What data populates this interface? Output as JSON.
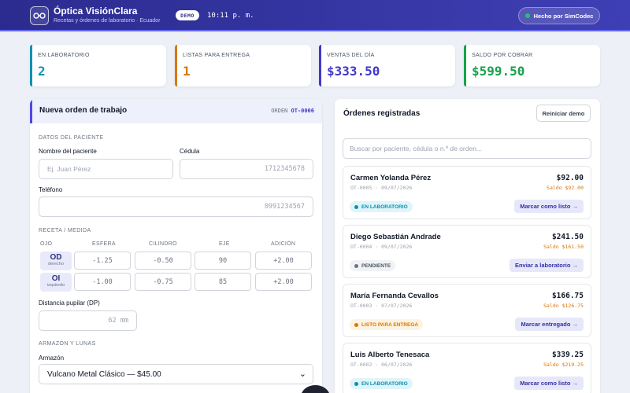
{
  "header": {
    "title": "Óptica VisiónClara",
    "subtitle": "Recetas y órdenes de laboratorio · Ecuador",
    "demo_badge": "DEMO",
    "clock": "10:11 p. m.",
    "made_by": "Hecho por SimCodec",
    "icon": "glasses-icon"
  },
  "stats": [
    {
      "label": "EN LABORATORIO",
      "value": "2",
      "color": "#0891b2"
    },
    {
      "label": "LISTAS PARA ENTREGA",
      "value": "1",
      "color": "#d97706"
    },
    {
      "label": "VENTAS DEL DÍA",
      "value": "$333.50",
      "color": "#4338ca"
    },
    {
      "label": "SALDO POR COBRAR",
      "value": "$599.50",
      "color": "#16a34a"
    }
  ],
  "form": {
    "title": "Nueva orden de trabajo",
    "order_label": "ORDEN",
    "order_code": "OT-0006",
    "patient_section": "DATOS DEL PACIENTE",
    "name_label": "Nombre del paciente",
    "name_placeholder": "Ej. Juan Pérez",
    "id_label": "Cédula",
    "id_placeholder": "1712345678",
    "phone_label": "Teléfono",
    "phone_placeholder": "0991234567",
    "rx_section": "RECETA / MEDIDA",
    "columns": [
      "OJO",
      "ESFERA",
      "CILINDRO",
      "EJE",
      "ADICIÓN"
    ],
    "od": {
      "eye": "OD",
      "side": "derecho",
      "esfera": "-1.25",
      "cilindro": "-0.50",
      "eje": "90",
      "adicion": "+2.00"
    },
    "oi": {
      "eye": "OI",
      "side": "izquierdo",
      "esfera": "-1.00",
      "cilindro": "-0.75",
      "eje": "85",
      "adicion": "+2.00"
    },
    "dp_label": "Distancia pupilar (DP)",
    "dp_placeholder": "62 mm",
    "frame_section": "ARMAZÓN Y LUNAS",
    "frame_label": "Armazón",
    "frame_value": "Vulcano Metal Clásico — $45.00"
  },
  "orders": {
    "title": "Órdenes registradas",
    "reset_label": "Reiniciar demo",
    "search_placeholder": "Buscar por paciente, cédula o n.º de orden...",
    "items": [
      {
        "name": "Carmen Yolanda Pérez",
        "meta": "OT-0005 · 09/07/2026",
        "total": "$92.00",
        "balance": "Saldo $92.00",
        "status": "EN LABORATORIO",
        "status_color": "#0891b2",
        "status_bg": "#e0f5fa",
        "action": "Marcar como listo →"
      },
      {
        "name": "Diego Sebastián Andrade",
        "meta": "OT-0004 · 09/07/2026",
        "total": "$241.50",
        "balance": "Saldo $161.50",
        "status": "PENDIENTE",
        "status_color": "#6b7280",
        "status_bg": "#f1f2f5",
        "action": "Enviar a laboratorio →"
      },
      {
        "name": "María Fernanda Cevallos",
        "meta": "OT-0003 · 07/07/2026",
        "total": "$166.75",
        "balance": "Saldo $126.75",
        "status": "LISTO PARA ENTREGA",
        "status_color": "#d97706",
        "status_bg": "#fdf3e2",
        "action": "Marcar entregado →"
      },
      {
        "name": "Luis Alberto Tenesaca",
        "meta": "OT-0002 · 06/07/2026",
        "total": "$339.25",
        "balance": "Saldo $219.25",
        "status": "EN LABORATORIO",
        "status_color": "#0891b2",
        "status_bg": "#e0f5fa",
        "action": "Marcar como listo →"
      }
    ]
  }
}
